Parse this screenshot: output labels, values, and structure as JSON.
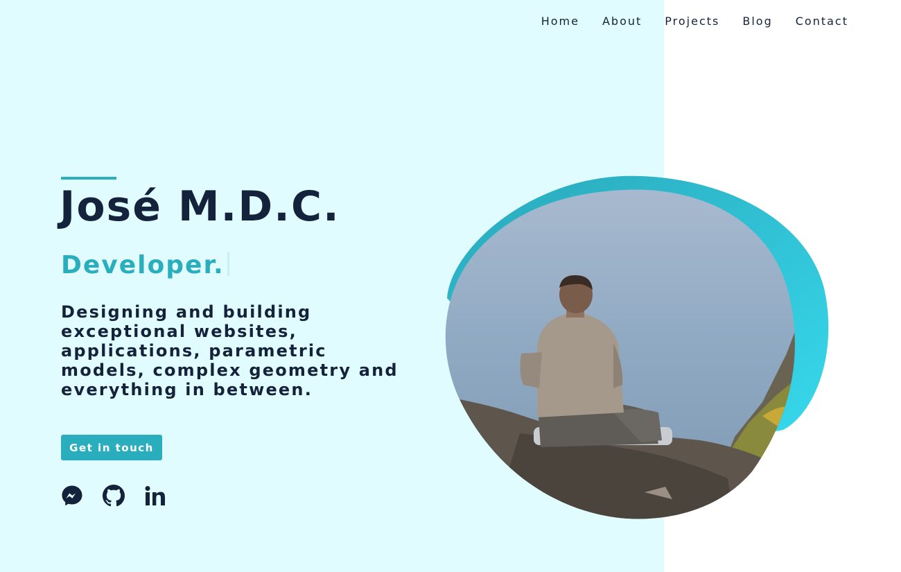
{
  "nav": {
    "items": [
      {
        "label": "Home"
      },
      {
        "label": "About"
      },
      {
        "label": "Projects"
      },
      {
        "label": "Blog"
      },
      {
        "label": "Contact"
      }
    ]
  },
  "hero": {
    "name": "José M.D.C.",
    "role": "Developer.",
    "tagline": "Designing and building exceptional websites, applications, parametric models, complex geometry and everything in between.",
    "cta_label": "Get in touch"
  },
  "socials": [
    {
      "icon": "messenger-icon"
    },
    {
      "icon": "github-icon"
    },
    {
      "icon": "linkedin-icon"
    }
  ],
  "colors": {
    "background_left": "#e0fcfe",
    "background_right": "#ffffff",
    "accent": "#2aaebe",
    "text_dark": "#14233b"
  }
}
